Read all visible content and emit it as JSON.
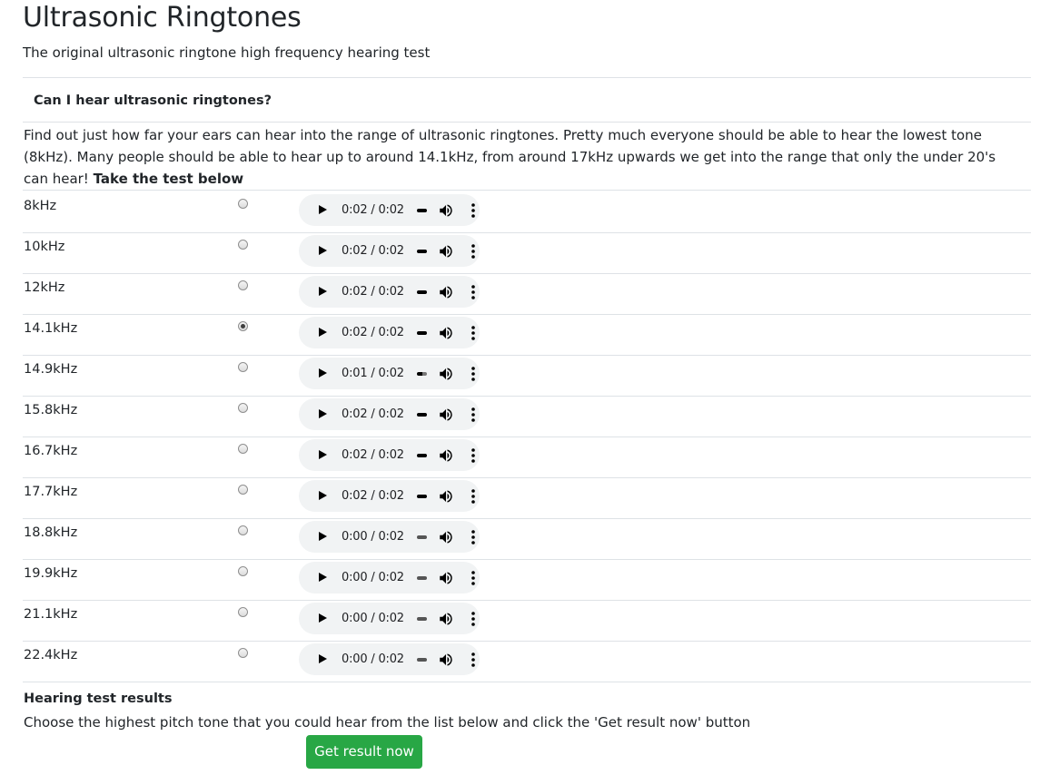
{
  "page": {
    "title": "Ultrasonic Ringtones",
    "subtitle": "The original ultrasonic ringtone high frequency hearing test"
  },
  "intro": {
    "heading": "Can I hear ultrasonic ringtones?",
    "text": "Find out just how far your ears can hear into the range of ultrasonic ringtones. Pretty much everyone should be able to hear the lowest tone (8kHz). Many people should be able to hear up to around 14.1kHz, from around 17kHz upwards we get into the range that only the under 20's can hear!",
    "cta": "Take the test below"
  },
  "tones": [
    {
      "label": "8kHz",
      "selected": false,
      "current": "0:02",
      "duration": "0:02",
      "progress": 1.0
    },
    {
      "label": "10kHz",
      "selected": false,
      "current": "0:02",
      "duration": "0:02",
      "progress": 1.0
    },
    {
      "label": "12kHz",
      "selected": false,
      "current": "0:02",
      "duration": "0:02",
      "progress": 1.0
    },
    {
      "label": "14.1kHz",
      "selected": true,
      "current": "0:02",
      "duration": "0:02",
      "progress": 1.0
    },
    {
      "label": "14.9kHz",
      "selected": false,
      "current": "0:01",
      "duration": "0:02",
      "progress": 0.5
    },
    {
      "label": "15.8kHz",
      "selected": false,
      "current": "0:02",
      "duration": "0:02",
      "progress": 1.0
    },
    {
      "label": "16.7kHz",
      "selected": false,
      "current": "0:02",
      "duration": "0:02",
      "progress": 1.0
    },
    {
      "label": "17.7kHz",
      "selected": false,
      "current": "0:02",
      "duration": "0:02",
      "progress": 1.0
    },
    {
      "label": "18.8kHz",
      "selected": false,
      "current": "0:00",
      "duration": "0:02",
      "progress": 0.0
    },
    {
      "label": "19.9kHz",
      "selected": false,
      "current": "0:00",
      "duration": "0:02",
      "progress": 0.0
    },
    {
      "label": "21.1kHz",
      "selected": false,
      "current": "0:00",
      "duration": "0:02",
      "progress": 0.0
    },
    {
      "label": "22.4kHz",
      "selected": false,
      "current": "0:00",
      "duration": "0:02",
      "progress": 0.0
    }
  ],
  "results": {
    "heading": "Hearing test results",
    "text": "Choose the highest pitch tone that you could hear from the list below and click the 'Get result now' button",
    "button_label": "Get result now"
  },
  "colors": {
    "button": "#28a745",
    "player_bg": "#f1f3f4",
    "rule": "#dee2e6"
  },
  "icons": {
    "play": "play-icon",
    "volume": "volume-icon",
    "more": "more-options-icon"
  }
}
